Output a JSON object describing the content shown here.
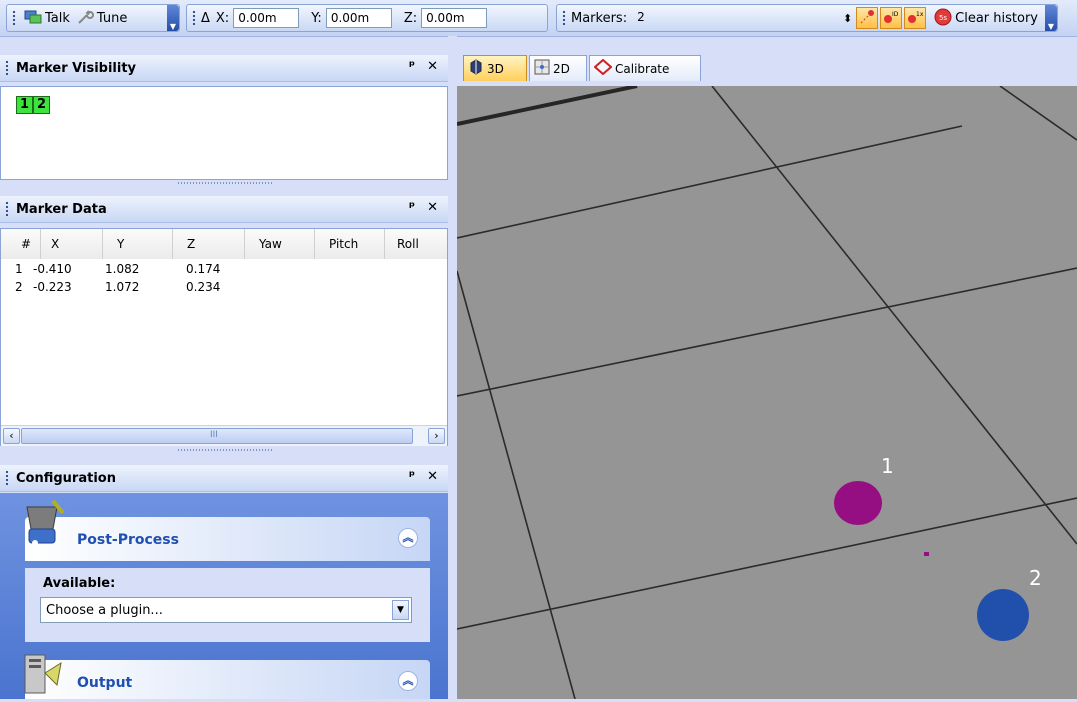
{
  "toolbar": {
    "talk_label": "Talk",
    "tune_label": "Tune",
    "delta_symbol": "Δ",
    "x_label": "X:",
    "x_value": "0.00m",
    "y_label": "Y:",
    "y_value": "0.00m",
    "z_label": "Z:",
    "z_value": "0.00m",
    "markers_label": "Markers:",
    "markers_value": "2",
    "clear_history_label": "Clear history",
    "marker_icon_labels": [
      "ID",
      "1x"
    ],
    "history_icon_label": "5s"
  },
  "marker_visibility": {
    "title": "Marker Visibility",
    "markers": [
      "1",
      "2"
    ]
  },
  "marker_data": {
    "title": "Marker Data",
    "columns": [
      "#",
      "X",
      "Y",
      "Z",
      "Yaw",
      "Pitch",
      "Roll"
    ],
    "rows": [
      {
        "id": "1",
        "x": "-0.410",
        "y": "1.082",
        "z": "0.174"
      },
      {
        "id": "2",
        "x": "-0.223",
        "y": "1.072",
        "z": "0.234"
      }
    ],
    "scroll_grip": "III"
  },
  "configuration": {
    "title": "Configuration",
    "post_process_title": "Post-Process",
    "available_label": "Available:",
    "plugin_select_value": "Choose a plugin...",
    "output_title": "Output"
  },
  "viewport": {
    "tabs": [
      "3D",
      "2D",
      "Calibrate"
    ],
    "active_tab": "3D",
    "markers": [
      {
        "label": "1",
        "color": "#960f82"
      },
      {
        "label": "2",
        "color": "#2150ac"
      }
    ],
    "floor_color": "#959595"
  },
  "colors": {
    "panel_bg": "#d6dff7",
    "accent_orange": "#ffbf45",
    "visibility_chip": "#3ee33e",
    "task_blue": "#1f4fb0"
  }
}
